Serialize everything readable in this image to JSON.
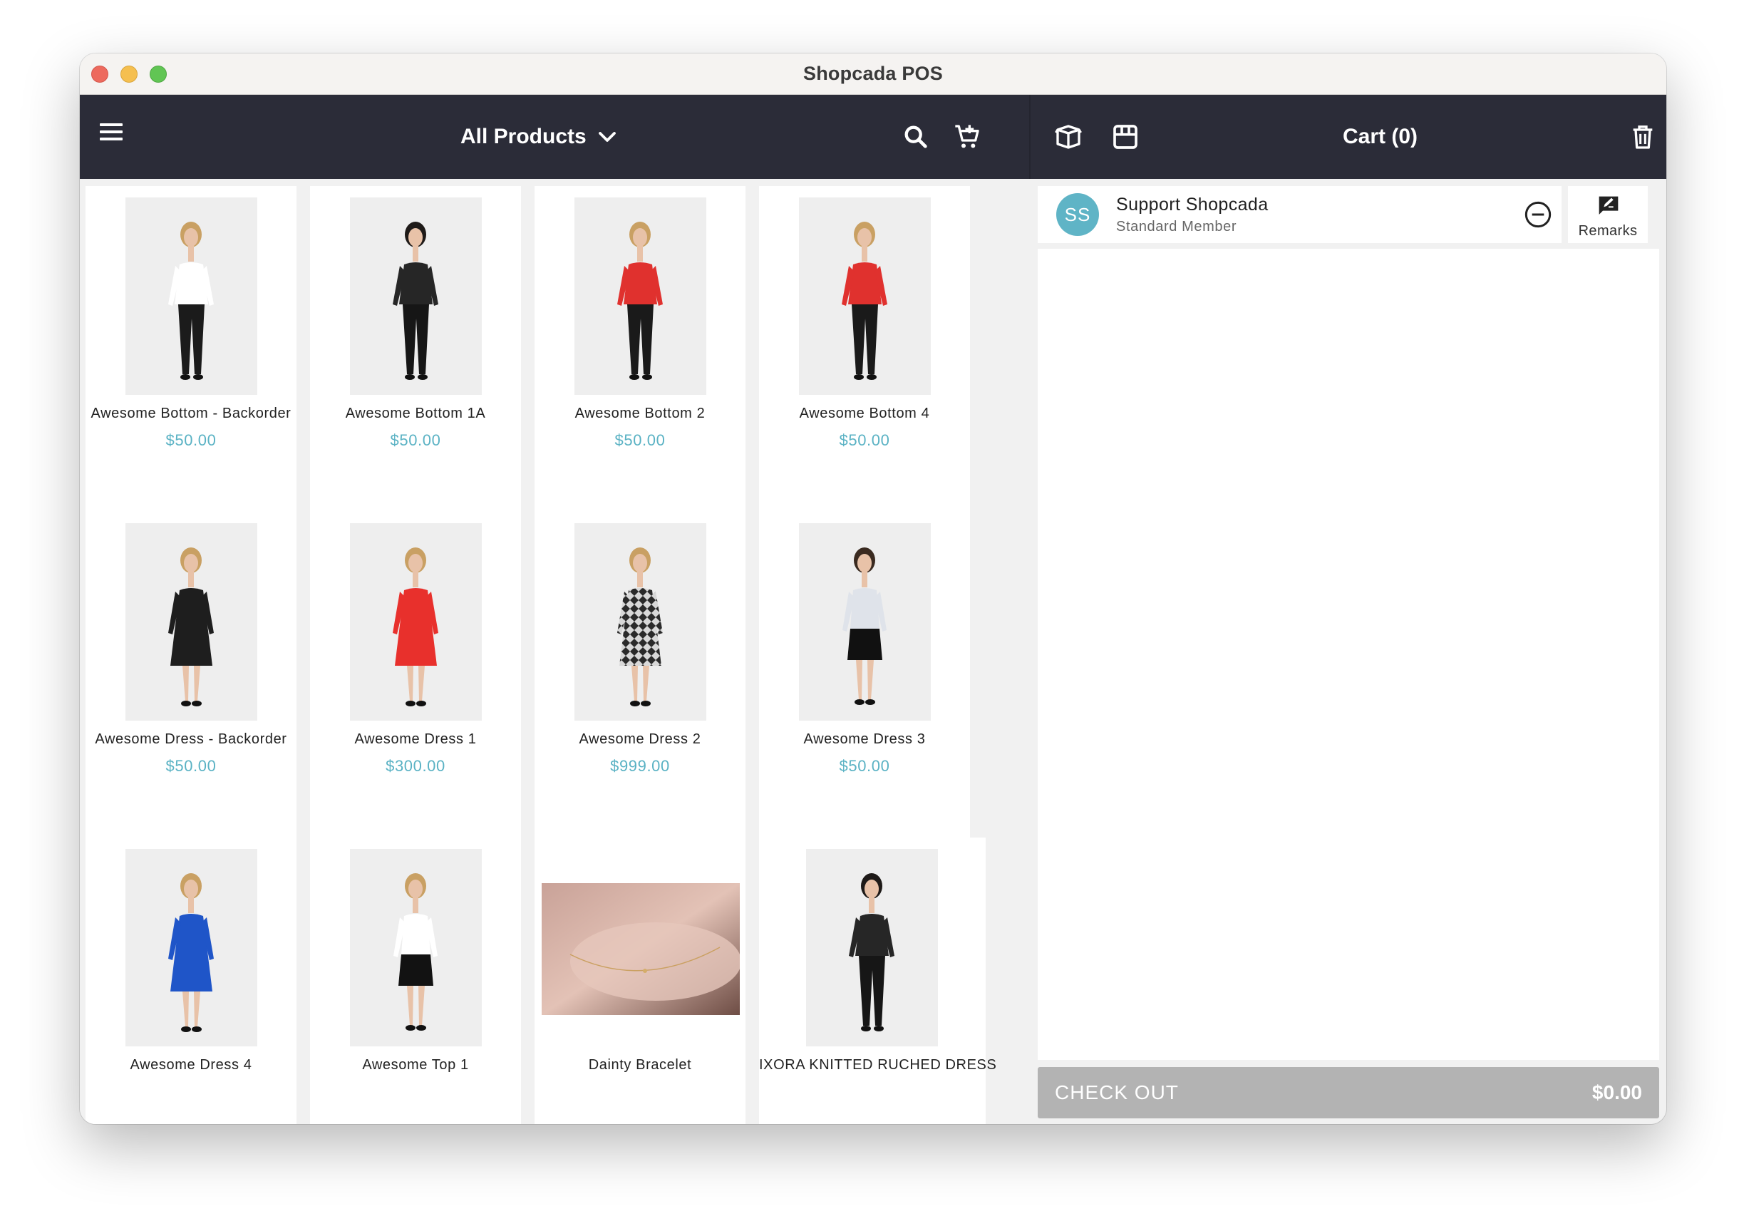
{
  "window": {
    "title": "Shopcada POS"
  },
  "toolbar": {
    "category_label": "All Products",
    "cart_title": "Cart (0)"
  },
  "colors": {
    "appbar": "#2b2c38",
    "price": "#5ab2c4",
    "avatar": "#5fb4c6",
    "checkout": "#b3b3b3"
  },
  "products": [
    {
      "name": "Awesome Bottom - Backorder",
      "price": "$50.00",
      "top": "#ffffff",
      "bottom": "#1b1b1b",
      "hair": "#c9a063",
      "style": "pants"
    },
    {
      "name": "Awesome Bottom 1A",
      "price": "$50.00",
      "top": "#262626",
      "bottom": "#161616",
      "hair": "#1e1a18",
      "style": "pants"
    },
    {
      "name": "Awesome Bottom 2",
      "price": "$50.00",
      "top": "#e0312e",
      "bottom": "#1a1a1a",
      "hair": "#c9a063",
      "style": "pants"
    },
    {
      "name": "Awesome Bottom 4",
      "price": "$50.00",
      "top": "#e0312e",
      "bottom": "#1a1a1a",
      "hair": "#c9a063",
      "style": "pants"
    },
    {
      "name": "Awesome Dress - Backorder",
      "price": "$50.00",
      "top": "#1e1e1e",
      "bottom": "#1e1e1e",
      "hair": "#c9a063",
      "style": "dress"
    },
    {
      "name": "Awesome Dress 1",
      "price": "$300.00",
      "top": "#e8302c",
      "bottom": "#e8302c",
      "hair": "#c9a063",
      "style": "dress"
    },
    {
      "name": "Awesome Dress 2",
      "price": "$999.00",
      "top": "#6a6a6a",
      "bottom": "#6a6a6a",
      "hair": "#c9a063",
      "style": "pattern"
    },
    {
      "name": "Awesome Dress 3",
      "price": "$50.00",
      "top": "#dfe3ea",
      "bottom": "#111111",
      "hair": "#3a2a20",
      "style": "skirt"
    },
    {
      "name": "Awesome Dress 4",
      "price": "",
      "top": "#1f55c8",
      "bottom": "#1f55c8",
      "hair": "#c9a063",
      "style": "dress"
    },
    {
      "name": "Awesome Top 1",
      "price": "",
      "top": "#ffffff",
      "bottom": "#121212",
      "hair": "#c9a063",
      "style": "skirt"
    },
    {
      "name": "Dainty Bracelet",
      "price": "",
      "top": "",
      "bottom": "",
      "hair": "",
      "style": "bracelet"
    },
    {
      "name": "IXORA KNITTED RUCHED DRESS",
      "price": "",
      "top": "#262626",
      "bottom": "#161616",
      "hair": "#1e1a18",
      "style": "pants"
    }
  ],
  "customer": {
    "initials": "SS",
    "name": "Support Shopcada",
    "tier": "Standard Member"
  },
  "remarks_label": "Remarks",
  "checkout": {
    "label": "CHECK OUT",
    "total": "$0.00"
  },
  "icons": [
    "menu-icon",
    "chevron-down-icon",
    "search-icon",
    "add-to-cart-icon",
    "package-icon",
    "store-icon",
    "trash-icon",
    "remove-circle-icon",
    "remarks-icon"
  ]
}
